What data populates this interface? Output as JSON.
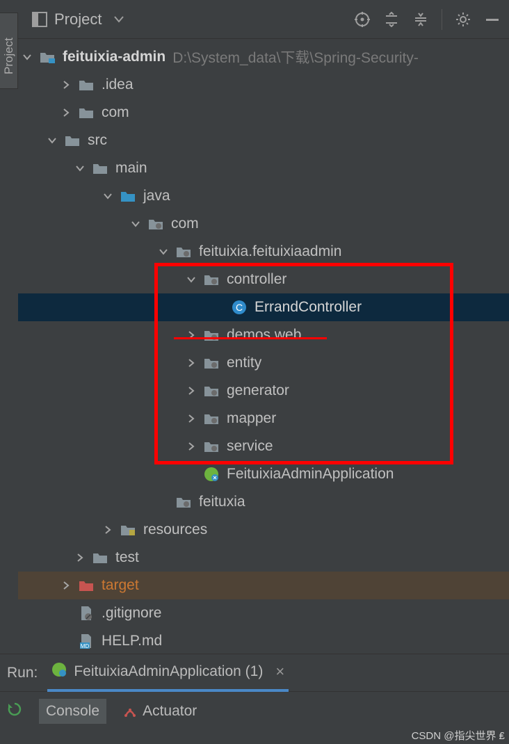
{
  "sidebar": {
    "tab_label": "Project"
  },
  "toolbar": {
    "project_label": "Project"
  },
  "tree": {
    "root": {
      "name": "feituixia-admin",
      "path": "D:\\System_data\\下载\\Spring-Security-"
    },
    "idea": ".idea",
    "com_top": "com",
    "src": "src",
    "main": "main",
    "java": "java",
    "com": "com",
    "pkg": "feituixia.feituixiaadmin",
    "controller": "controller",
    "errand": "ErrandController",
    "demos": "demos.web",
    "entity": "entity",
    "generator": "generator",
    "mapper": "mapper",
    "service": "service",
    "app_class": "FeituixiaAdminApplication",
    "feituxia": "feituxia",
    "resources": "resources",
    "test": "test",
    "target": "target",
    "gitignore": ".gitignore",
    "helpmd": "HELP.md"
  },
  "run": {
    "label": "Run:",
    "app": "FeituixiaAdminApplication (1)",
    "tab_console": "Console",
    "tab_actuator": "Actuator"
  },
  "watermark": "CSDN @指尖世界 ₤"
}
